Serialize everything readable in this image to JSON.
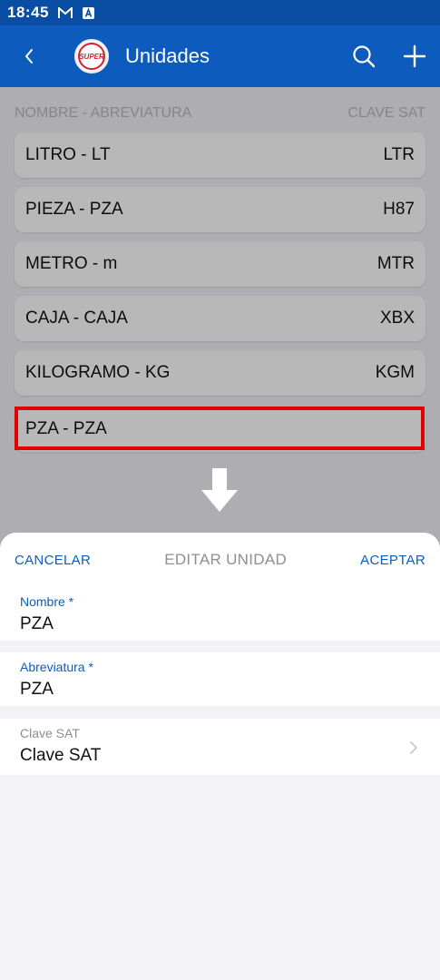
{
  "status_bar": {
    "time": "18:45",
    "icons": [
      "gmail-icon",
      "notification-a-icon"
    ]
  },
  "app_bar": {
    "title": "Unidades",
    "logo_text": "SUPER",
    "back_icon": "chevron-left-icon",
    "actions": [
      "search-icon",
      "plus-icon"
    ]
  },
  "list": {
    "header_left": "NOMBRE - ABREVIATURA",
    "header_right": "CLAVE SAT",
    "rows": [
      {
        "name": "LITRO - LT",
        "code": "LTR"
      },
      {
        "name": "PIEZA - PZA",
        "code": "H87"
      },
      {
        "name": "METRO - m",
        "code": "MTR"
      },
      {
        "name": "CAJA - CAJA",
        "code": "XBX"
      },
      {
        "name": "KILOGRAMO - KG",
        "code": "KGM"
      },
      {
        "name": "PZA - PZA",
        "code": ""
      }
    ]
  },
  "sheet": {
    "cancel_label": "CANCELAR",
    "title": "EDITAR UNIDAD",
    "accept_label": "ACEPTAR",
    "fields": [
      {
        "label": "Nombre *",
        "value": "PZA"
      },
      {
        "label": "Abreviatura *",
        "value": "PZA"
      },
      {
        "label": "Clave SAT",
        "value": "Clave SAT"
      }
    ]
  },
  "colors": {
    "status_bar": "#0a4ea3",
    "app_bar": "#0d5cbd",
    "accent": "#0d5cbd",
    "highlight": "#e00000",
    "logo_red": "#d4202a"
  }
}
